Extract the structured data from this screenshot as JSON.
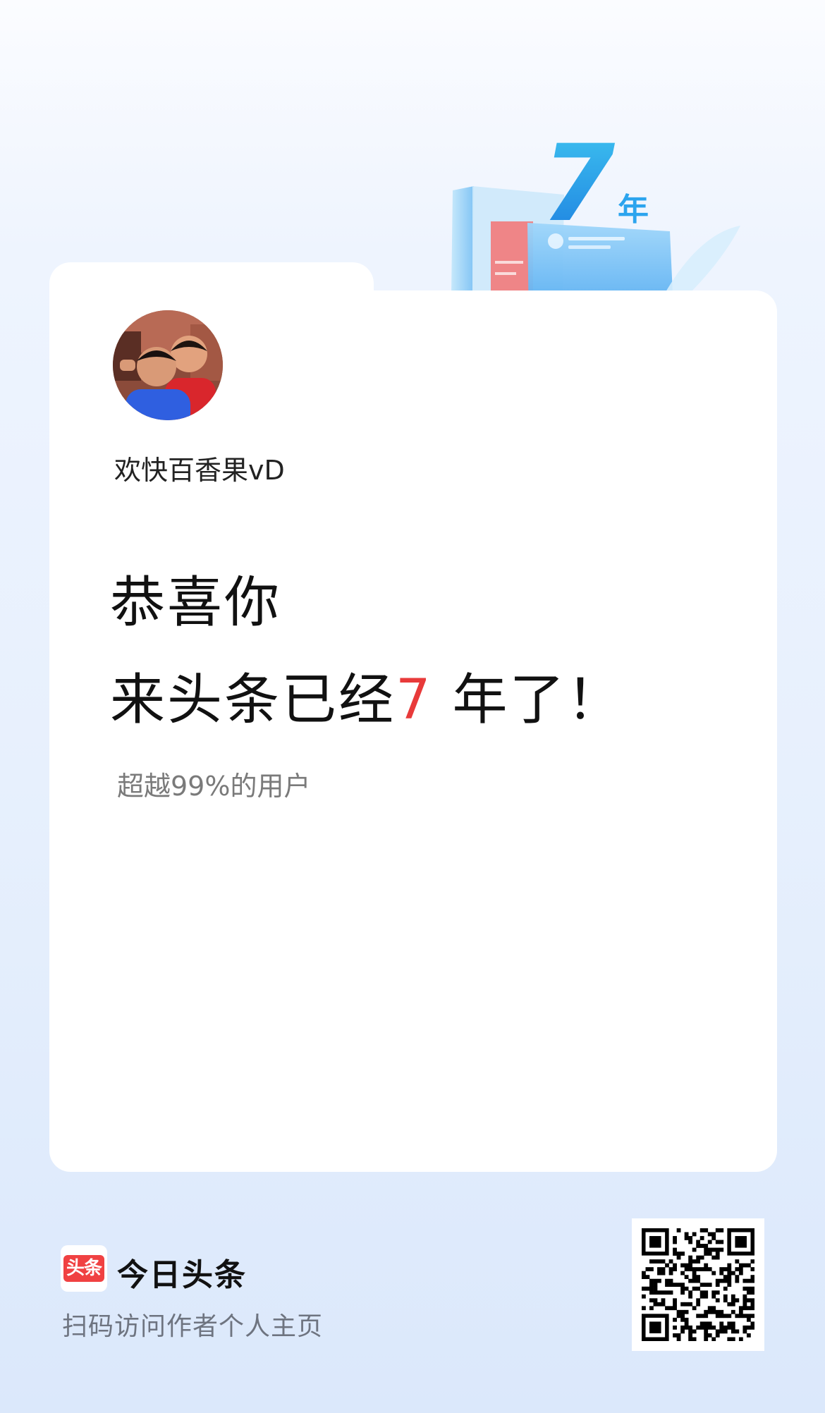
{
  "profile": {
    "username": "欢快百香果vD"
  },
  "anniversary": {
    "badge_number": "7",
    "badge_unit": "年",
    "line1": "恭喜你",
    "line2_prefix": "来头条已经",
    "years": "7",
    "line2_suffix": " 年了！",
    "subline": "超越99%的用户"
  },
  "footer": {
    "logo_text": "头条",
    "app_name": "今日头条",
    "hint": "扫码访问作者个人主页"
  },
  "colors": {
    "accent_red": "#e83a3a",
    "brand_red": "#f04142",
    "badge_blue": "#2ba4ee"
  }
}
